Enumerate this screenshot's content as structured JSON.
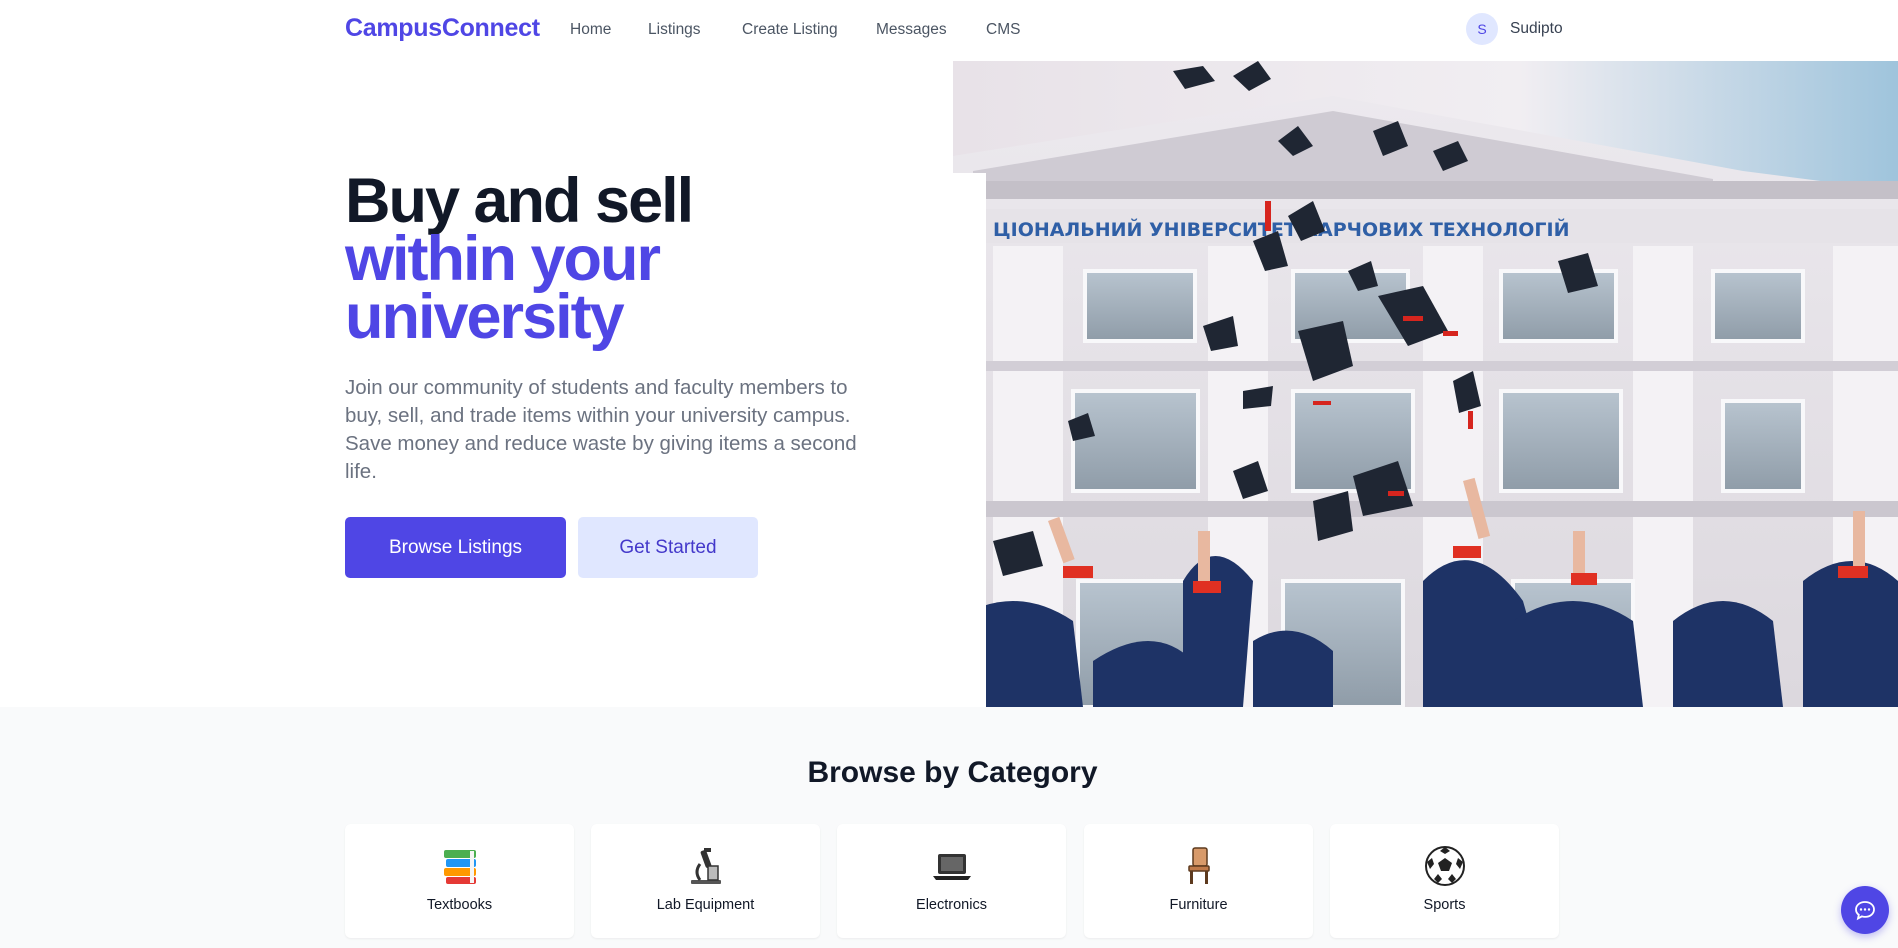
{
  "nav": {
    "logo": "CampusConnect",
    "links": [
      "Home",
      "Listings",
      "Create Listing",
      "Messages",
      "CMS"
    ],
    "user": {
      "initial": "S",
      "name": "Sudipto"
    }
  },
  "hero": {
    "title_line1": "Buy and sell",
    "title_line2": "within your",
    "title_line3": "university",
    "description": "Join our community of students and faculty members to buy, sell, and trade items within your university campus. Save money and reduce waste by giving items a second life.",
    "primary_button": "Browse Listings",
    "secondary_button": "Get Started",
    "image_icon": "graduation-caps-photo",
    "image_banner_text": "ЦІОНАЛЬНИЙ УНІВЕРСИТЕТ ХАРЧОВИХ ТЕХНОЛОГІЙ"
  },
  "categories": {
    "title": "Browse by Category",
    "items": [
      {
        "label": "Textbooks",
        "icon": "books-icon"
      },
      {
        "label": "Lab Equipment",
        "icon": "microscope-icon"
      },
      {
        "label": "Electronics",
        "icon": "laptop-icon"
      },
      {
        "label": "Furniture",
        "icon": "chair-icon"
      },
      {
        "label": "Sports",
        "icon": "soccer-ball-icon"
      }
    ]
  },
  "chat": {
    "icon": "chat-bubble-icon"
  },
  "colors": {
    "brand": "#4f46e5",
    "brand_light": "#e0e7ff",
    "text_dark": "#111827",
    "text_muted": "#6b7280"
  }
}
